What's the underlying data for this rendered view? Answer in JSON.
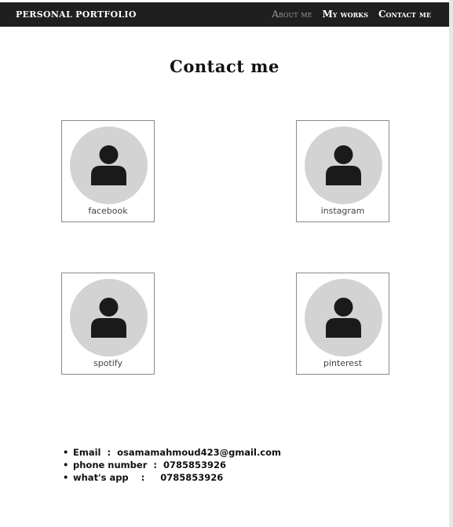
{
  "navbar": {
    "brand": "PERSONAL PORTFOLIO",
    "links": [
      {
        "label": "About me",
        "active": false
      },
      {
        "label": "My works",
        "active": true
      },
      {
        "label": "Contact me",
        "active": true
      }
    ]
  },
  "main": {
    "title": "Contact me",
    "cards": [
      {
        "label": "facebook",
        "icon": "user-icon"
      },
      {
        "label": "instagram",
        "icon": "user-icon"
      },
      {
        "label": "spotify",
        "icon": "user-icon"
      },
      {
        "label": "pinterest",
        "icon": "user-icon"
      }
    ],
    "contacts": [
      {
        "text": "Email  :  osamamahmoud423@gmail.com"
      },
      {
        "text": "phone number  :  0785853926"
      },
      {
        "text": "what's app    :     0785853926"
      }
    ]
  },
  "colors": {
    "navbar_bg": "#1f1f1f",
    "avatar_bg": "#d3d3d3",
    "muted_link": "#9a9a9a"
  }
}
